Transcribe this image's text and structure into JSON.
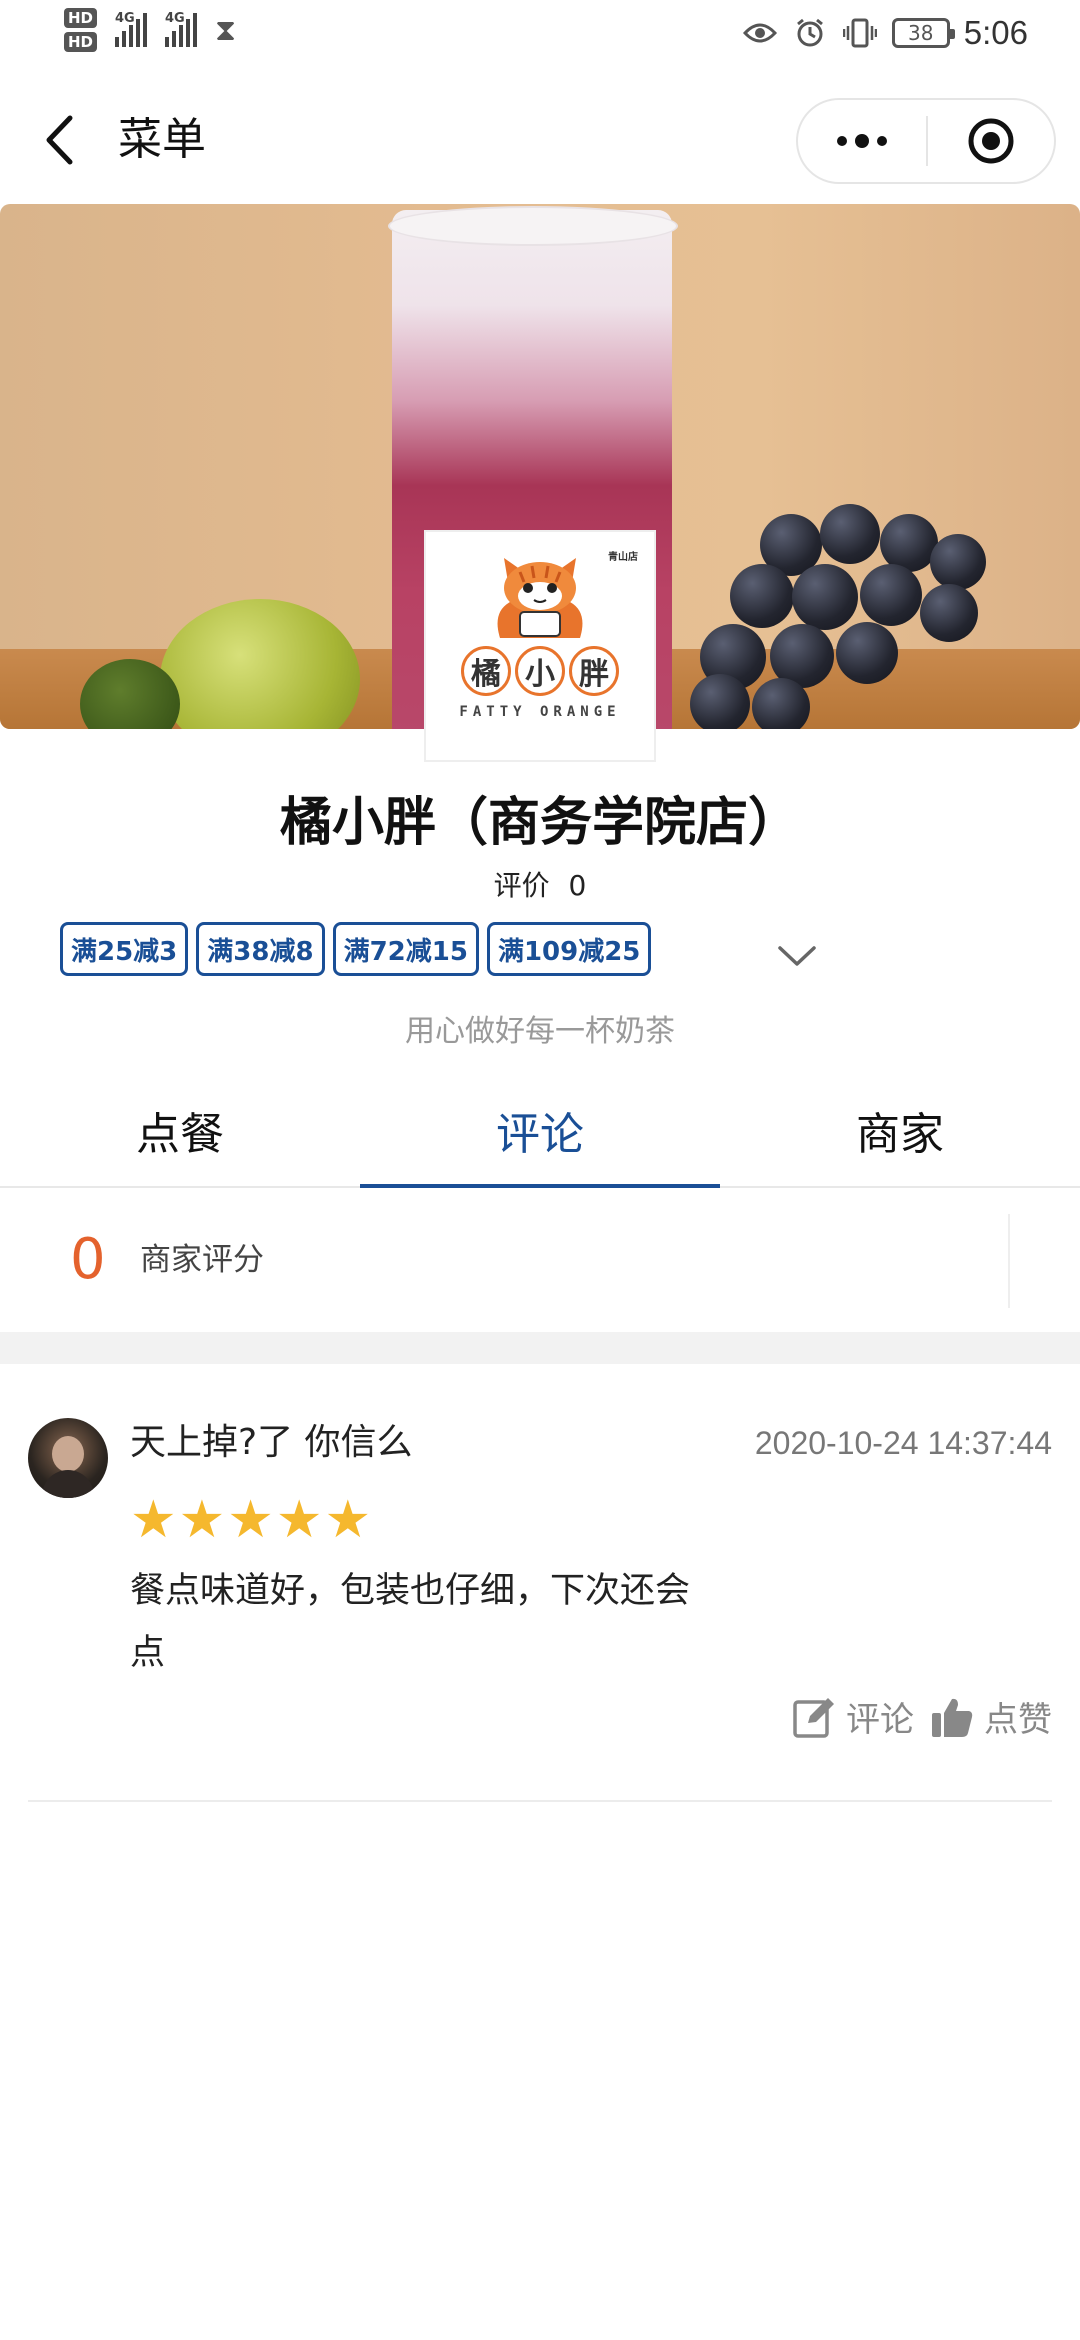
{
  "status_bar": {
    "hd1": "HD",
    "hd2": "HD",
    "net1": "4G",
    "net2": "4G",
    "battery": "38",
    "time": "5:06"
  },
  "nav": {
    "title": "菜单"
  },
  "logo": {
    "branch": "青山店",
    "chars": [
      "橘",
      "小",
      "胖"
    ],
    "en": "FATTY ORANGE"
  },
  "shop": {
    "name": "橘小胖（商务学院店）",
    "rating_label": "评价",
    "rating_value": "0",
    "promos": [
      "满25减3",
      "满38减8",
      "满72减15",
      "满109减25"
    ],
    "slogan": "用心做好每一杯奶茶"
  },
  "tabs": [
    {
      "label": "点餐",
      "active": false
    },
    {
      "label": "评论",
      "active": true
    },
    {
      "label": "商家",
      "active": false
    }
  ],
  "score": {
    "value": "0",
    "label": "商家评分"
  },
  "review": {
    "user": "天上掉?了 你信么",
    "time": "2020-10-24 14:37:44",
    "stars": 5,
    "text": "餐点味道好，包装也仔细，下次还会点",
    "comment_label": "评论",
    "like_label": "点赞"
  },
  "colors": {
    "accent": "#1a4f96",
    "score": "#e4622d",
    "star": "#f5b82e",
    "logo_orange": "#e8742c"
  }
}
